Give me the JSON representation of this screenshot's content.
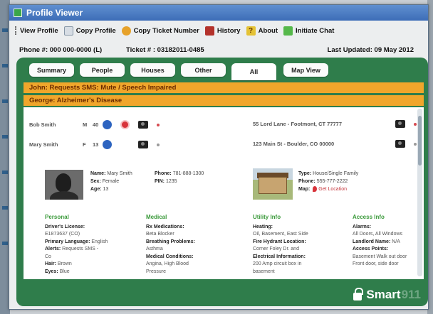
{
  "window": {
    "title": "Profile Viewer"
  },
  "toolbar": {
    "view_profile": "View Profile",
    "copy_profile": "Copy Profile",
    "copy_ticket": "Copy Ticket Number",
    "history": "History",
    "about": "About",
    "about_icon_glyph": "?",
    "initiate_chat": "Initiate Chat"
  },
  "info": {
    "phone": "Phone #: 000 000-0000 (L)",
    "ticket": "Ticket # : 03182011-0485",
    "updated": "Last Updated: 09 May 2012"
  },
  "tabs": [
    "Summary",
    "People",
    "Houses",
    "Other",
    "All",
    "Map View"
  ],
  "alerts": [
    "John: Requests SMS: Mute / Speech Impaired",
    "George: Alzheimer's Disease"
  ],
  "people": [
    {
      "name": "Bob Smith",
      "sex": "M",
      "age": "40"
    },
    {
      "name": "Mary Smith",
      "sex": "F",
      "age": "13"
    }
  ],
  "addresses": [
    "55 Lord Lane - Footmont, CT 77777",
    "123 Main St - Boulder, CO 00000"
  ],
  "person_detail": {
    "name_label": "Name:",
    "name": "Mary Smith",
    "phone_label": "Phone:",
    "phone": "781-888-1300",
    "sex_label": "Sex:",
    "sex": "Female",
    "pin_label": "PIN:",
    "pin": "1235",
    "age_label": "Age:",
    "age": "13"
  },
  "house_detail": {
    "type_label": "Type:",
    "type": "House/Single Family",
    "phone_label": "Phone:",
    "phone": "555-777-2222",
    "map_label": "Map:",
    "map_link": "Get Location"
  },
  "columns": {
    "personal": {
      "heading": "Personal",
      "l1": "Driver's License:",
      "l2": "E1873637 (CO)",
      "l3": "Primary Language:",
      "l3v": "English",
      "l4": "Alerts:",
      "l4v": "Requests SMS -",
      "l5": "Co",
      "l6": "Hair:",
      "l6v": "Brown",
      "l7": "Eyes:",
      "l7v": "Blue"
    },
    "medical": {
      "heading": "Medical",
      "l1": "Rx Medications:",
      "l2": "Beta Blocker",
      "l3": "Breathing Problems:",
      "l4": "Asthma",
      "l5": "Medical Conditions:",
      "l6": "Angina, High Blood",
      "l7": "Pressure"
    },
    "utility": {
      "heading": "Utility Info",
      "l1": "Heating:",
      "l2": "Oil, Basement, East Side",
      "l3": "Fire Hydrant Location:",
      "l4": "Corner Foley Dr. and",
      "l5": "Electrical Information:",
      "l6": "200 Amp circuit box in",
      "l7": "basement"
    },
    "access": {
      "heading": "Access Info",
      "l1": "Alarms:",
      "l2": "All Doors, All Windows",
      "l3": "Landlord Name:",
      "l3v": "N/A",
      "l4": "Access Points:",
      "l5": "Basement Walk out door",
      "l6": "Front door, side door"
    }
  },
  "brand": {
    "name": "Smart",
    "suffix": "911"
  },
  "colors": {
    "panel_green": "#2f7d4b",
    "alert_orange": "#f0a62b",
    "heading_green": "#3b9a3b",
    "titlebar_blue": "#4a7cc4"
  }
}
